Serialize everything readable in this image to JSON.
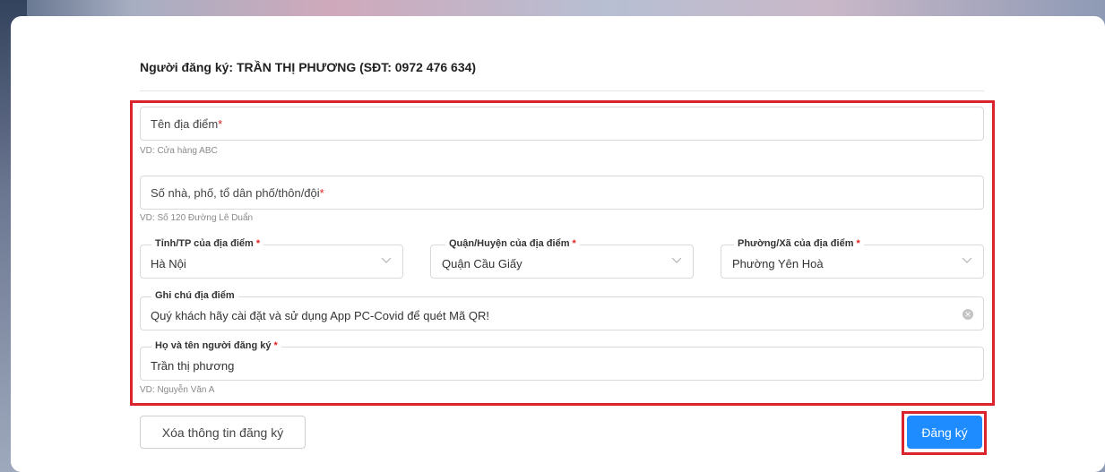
{
  "form": {
    "registrant_heading": "Người đăng ký: TRẦN THỊ PHƯƠNG (SĐT: 0972 476 634)",
    "place_name": {
      "placeholder": "Tên địa điểm",
      "required_mark": "*",
      "hint": "VD: Cửa hàng ABC"
    },
    "address": {
      "placeholder": "Số nhà, phố, tổ dân phố/thôn/đội",
      "required_mark": "*",
      "hint": "VD: Số 120 Đường Lê Duẩn"
    },
    "province": {
      "label": "Tỉnh/TP của địa điểm",
      "required_mark": "*",
      "value": "Hà Nội"
    },
    "district": {
      "label": "Quận/Huyện của địa điểm",
      "required_mark": "*",
      "value": "Quận Cầu Giấy"
    },
    "ward": {
      "label": "Phường/Xã của địa điểm",
      "required_mark": "*",
      "value": "Phường Yên Hoà"
    },
    "note": {
      "label": "Ghi chú địa điểm",
      "value": "Quý khách hãy cài đặt và sử dụng App PC-Covid để quét Mã QR!",
      "clear_icon": "close-circle-icon"
    },
    "registrant_name": {
      "label": "Họ và tên người đăng ký",
      "required_mark": "*",
      "value": "Trần thị phương",
      "hint": "VD: Nguyễn Văn A"
    }
  },
  "actions": {
    "clear_label": "Xóa thông tin đăng ký",
    "submit_label": "Đăng ký"
  },
  "colors": {
    "required": "#e02424",
    "primary": "#1e8cff",
    "highlight_box": "#d9232d"
  }
}
